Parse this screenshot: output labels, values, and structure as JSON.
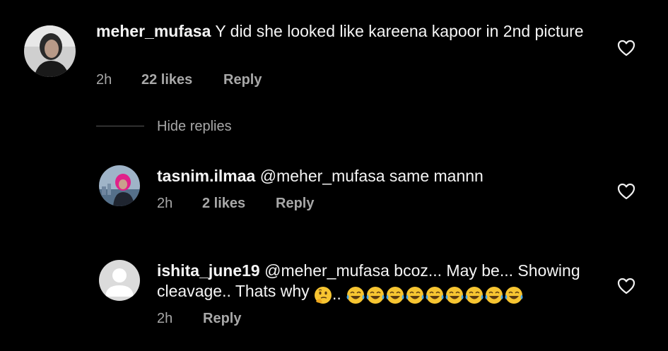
{
  "colors": {
    "background": "#000000",
    "text": "#f5f5f5",
    "meta": "#a8a8a8"
  },
  "comments": [
    {
      "username": "meher_mufasa",
      "text": "Y did she looked like kareena kapoor in 2nd picture",
      "time": "2h",
      "likes": "22 likes",
      "reply": "Reply",
      "icon": "heart-outline-icon"
    }
  ],
  "hide_replies": "Hide replies",
  "replies": [
    {
      "username": "tasnim.ilmaa",
      "text": "@meher_mufasa same mannn",
      "time": "2h",
      "likes": "2 likes",
      "reply": "Reply",
      "icon": "heart-outline-icon"
    },
    {
      "username": "ishita_june19",
      "text": "@meher_mufasa bcoz... May be... Showing cleavage.. Thats why",
      "emoji_text": "..",
      "emojis": [
        "thinking-face-icon",
        "tears-of-joy-icon",
        "tears-of-joy-icon",
        "tears-of-joy-icon",
        "tears-of-joy-icon",
        "tears-of-joy-icon",
        "tears-of-joy-icon",
        "tears-of-joy-icon",
        "tears-of-joy-icon",
        "tears-of-joy-icon"
      ],
      "time": "2h",
      "reply": "Reply",
      "icon": "heart-outline-icon"
    }
  ]
}
